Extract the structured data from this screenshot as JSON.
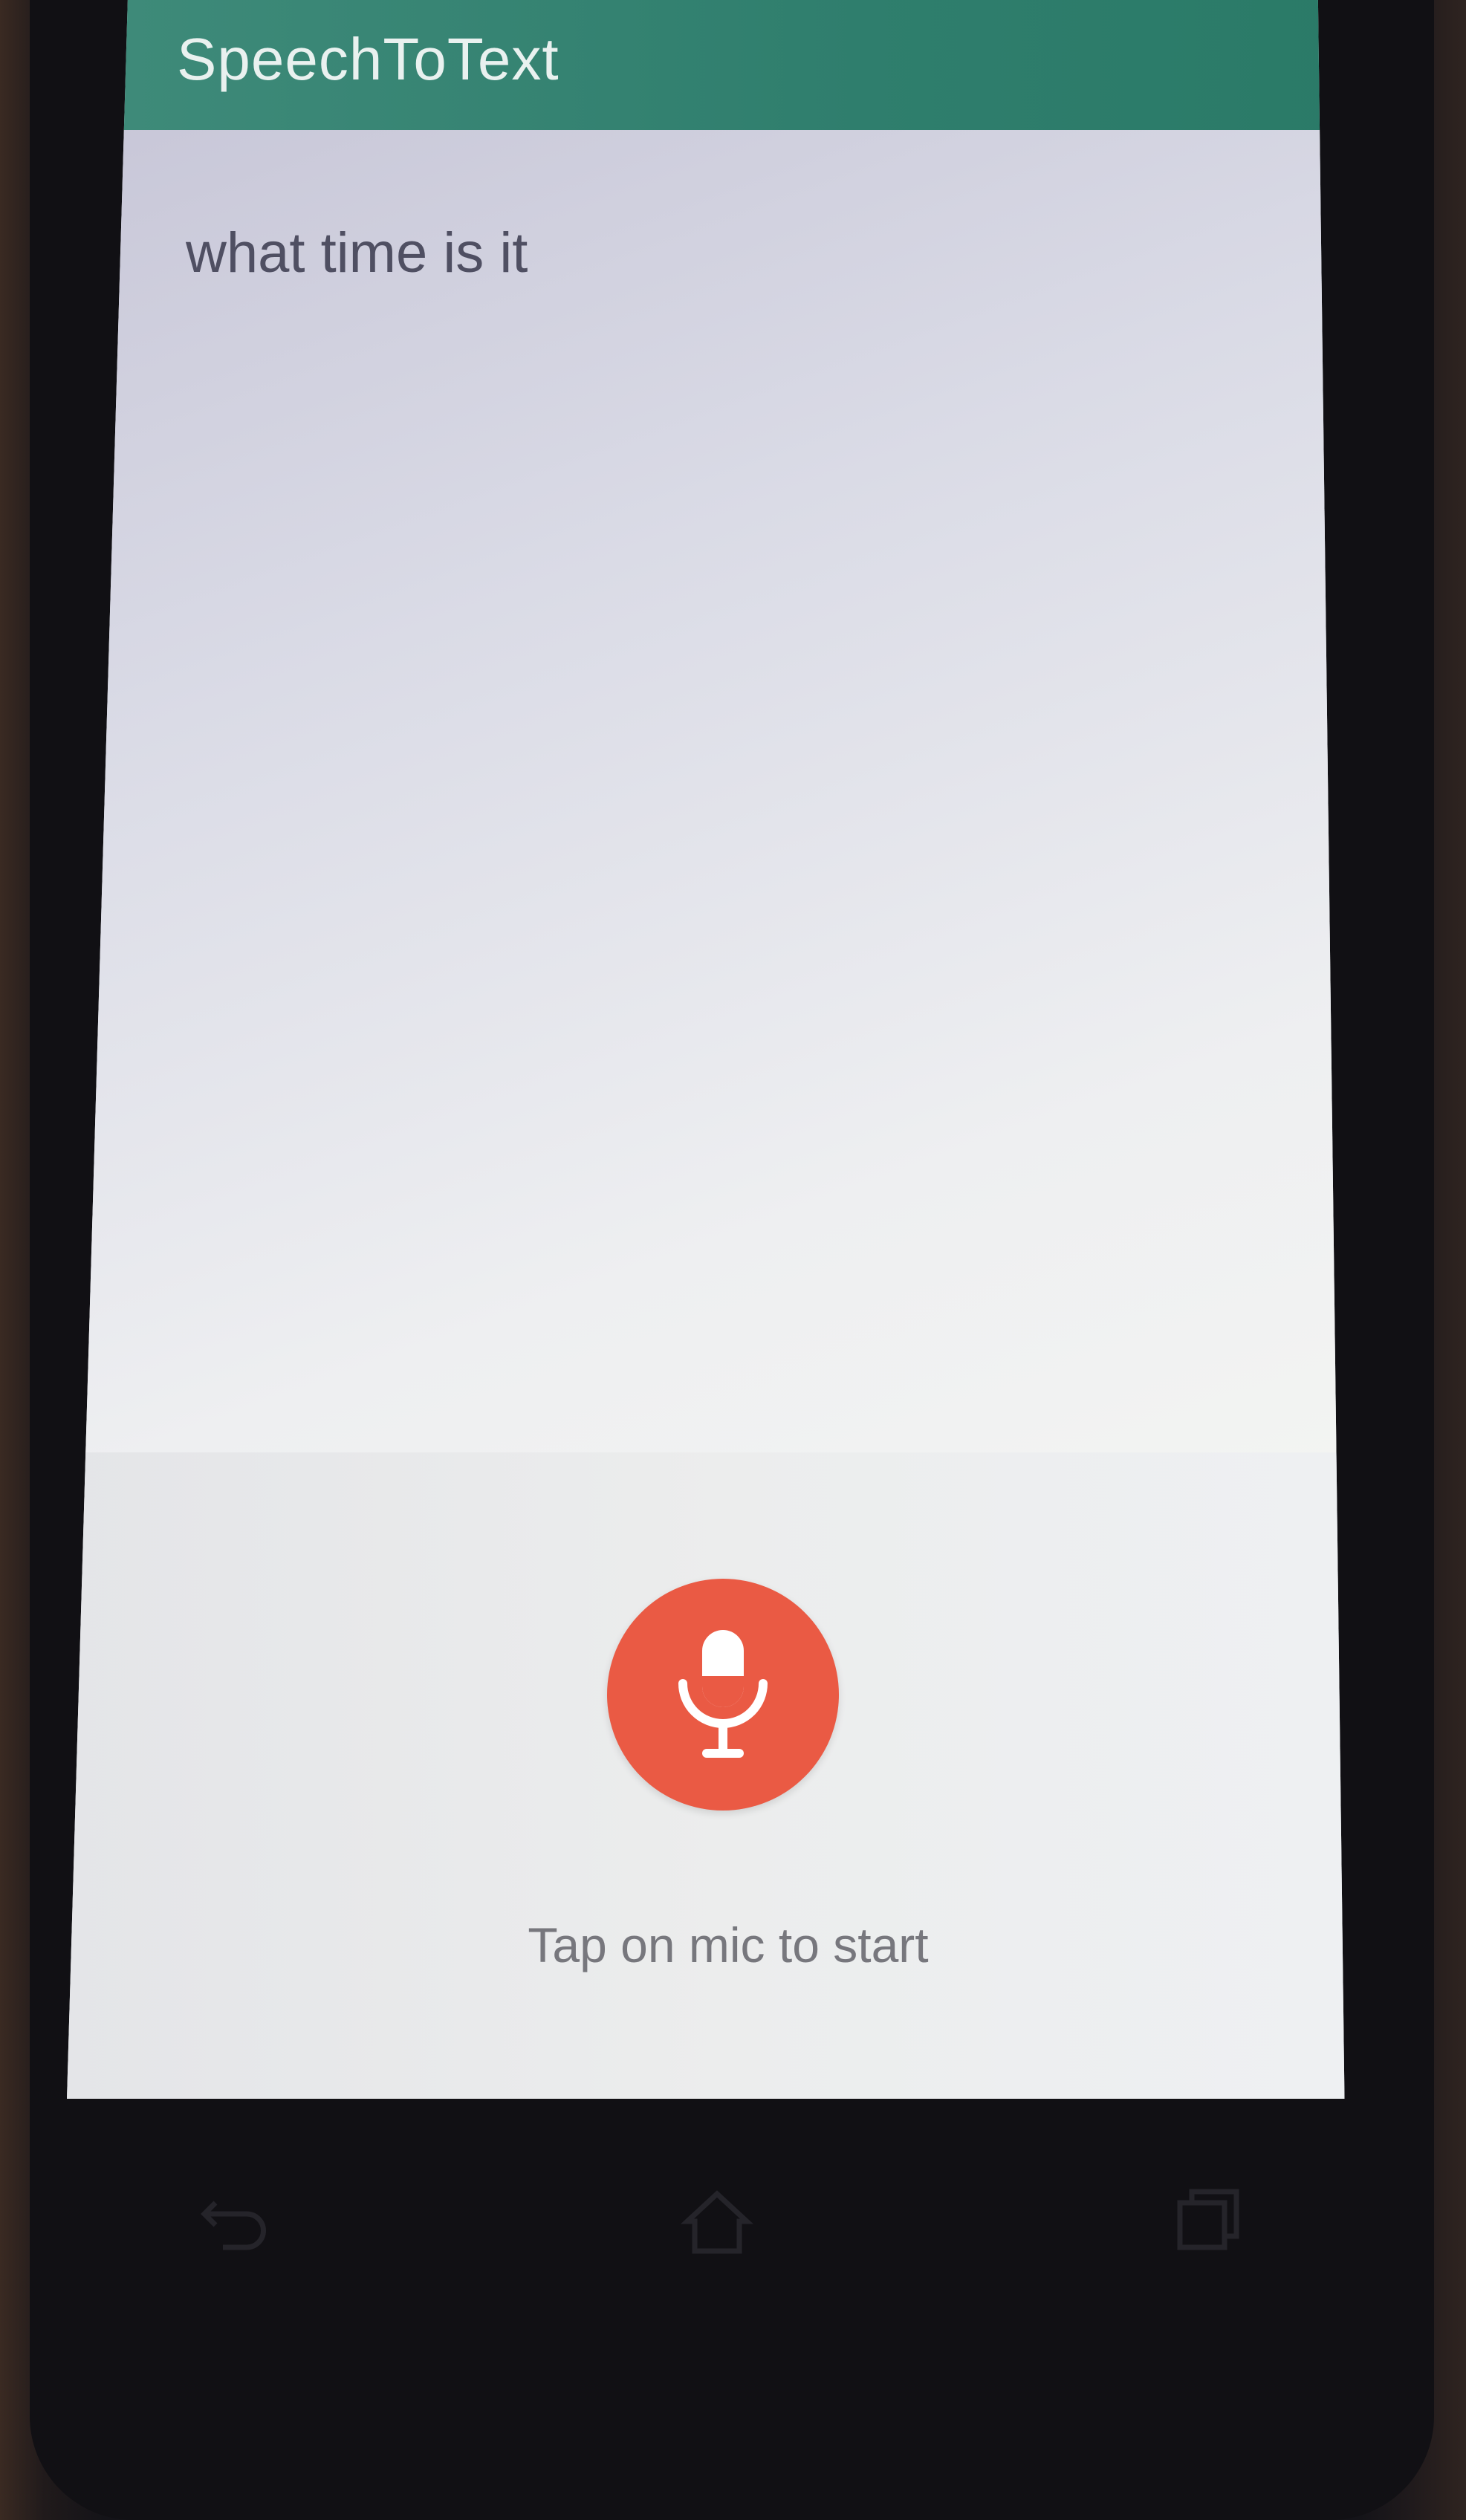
{
  "app_bar": {
    "title": "SpeechToText",
    "color": "#2f7e6d"
  },
  "content": {
    "recognized_text": "what time is it"
  },
  "mic_panel": {
    "mic_icon": "microphone-icon",
    "mic_color": "#ea5a44",
    "hint": "Tap on mic to start"
  },
  "nav_bar": {
    "icons": [
      "back-icon",
      "home-icon",
      "recents-icon"
    ]
  }
}
